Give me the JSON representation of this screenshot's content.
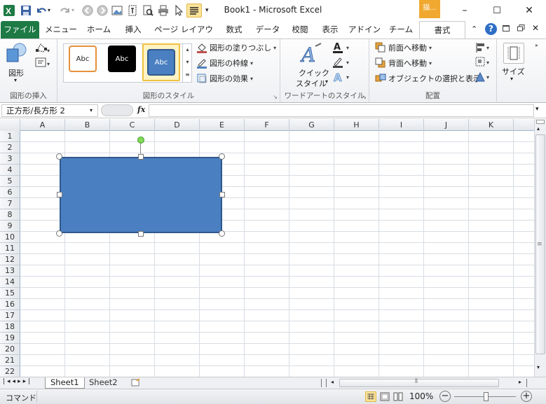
{
  "window": {
    "title": "Book1 - Microsoft Excel",
    "context_tab_label": "描...",
    "minimize": "–",
    "maximize": "☐",
    "close": "✕"
  },
  "tabs": [
    {
      "label": "ファイル"
    },
    {
      "label": "メニュー"
    },
    {
      "label": "ホーム"
    },
    {
      "label": "挿入"
    },
    {
      "label": "ページ レイアウト"
    },
    {
      "label": "数式"
    },
    {
      "label": "データ"
    },
    {
      "label": "校閲"
    },
    {
      "label": "表示"
    },
    {
      "label": "アドイン"
    },
    {
      "label": "チーム"
    },
    {
      "label": "書式"
    }
  ],
  "ribbon": {
    "insert_shapes": {
      "shapes_label": "図形",
      "group_label": "図形の挿入"
    },
    "shape_styles": {
      "swatch_text": "Abc",
      "fill": "図形の塗りつぶし",
      "outline": "図形の枠線",
      "effects": "図形の効果",
      "group_label": "図形のスタイル"
    },
    "wordart": {
      "quick_style": "クイック",
      "quick_style2": "スタイル",
      "group_label": "ワードアートのスタイル"
    },
    "arrange": {
      "bring_forward": "前面へ移動",
      "send_backward": "背面へ移動",
      "selection_pane": "オブジェクトの選択と表示",
      "group_label": "配置"
    },
    "size": {
      "label": "サイズ"
    }
  },
  "formula_bar": {
    "name_box": "正方形/長方形 2",
    "fx": "fx",
    "value": ""
  },
  "grid": {
    "columns": [
      "A",
      "B",
      "C",
      "D",
      "E",
      "F",
      "G",
      "H",
      "I",
      "J",
      "K"
    ],
    "rows": [
      "1",
      "2",
      "3",
      "4",
      "5",
      "6",
      "7",
      "8",
      "9",
      "10",
      "11",
      "12",
      "13",
      "14",
      "15",
      "16",
      "17",
      "18",
      "19",
      "20",
      "21",
      "22"
    ]
  },
  "sheets": [
    {
      "label": "Sheet1",
      "active": true
    },
    {
      "label": "Sheet2",
      "active": false
    }
  ],
  "status": {
    "mode": "コマンド",
    "zoom": "100%"
  },
  "colors": {
    "file_tab": "#1d7a45",
    "shape_fill": "#4a7fc1",
    "shape_border": "#30598c",
    "context_tab": "#f0a830"
  }
}
